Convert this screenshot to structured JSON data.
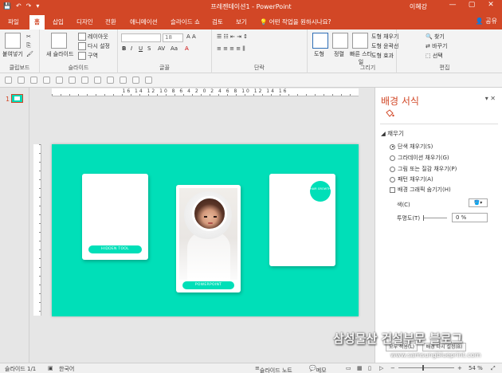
{
  "titlebar": {
    "title": "프레젠테이션1 - PowerPoint",
    "user": "이혜강",
    "qat": [
      "💾",
      "↶",
      "↷",
      "▾"
    ],
    "min": "—",
    "max": "▢",
    "close": "✕"
  },
  "tabs": {
    "file": "파일",
    "home": "홈",
    "insert": "삽입",
    "design": "디자인",
    "transitions": "전환",
    "animations": "애니메이션",
    "slideshow": "슬라이드 쇼",
    "review": "검토",
    "view": "보기",
    "tellme": "어떤 작업을 원하시나요?",
    "share": "공유"
  },
  "ribbon": {
    "paste": "붙여넣기",
    "clipboard": "클립보드",
    "new_slide": "새 슬라이드",
    "layout": "레이아웃",
    "reset": "다시 설정",
    "section": "구역",
    "slides": "슬라이드",
    "font_size": "18",
    "font": "글꼴",
    "paragraph": "단락",
    "shapes": "도형",
    "arrange": "정렬",
    "quick_styles": "빠른 스타일",
    "shape_fill": "도형 채우기",
    "shape_outline": "도형 윤곽선",
    "shape_effects": "도형 효과",
    "drawing": "그리기",
    "find": "찾기",
    "replace": "바꾸기",
    "select": "선택",
    "editing": "편집"
  },
  "ruler": {
    "h_labels": "16 14 12 10 8 6 4 2 0 2 4 6 8 10 12 14 16"
  },
  "thumbnails": {
    "slide_number": "1"
  },
  "slide": {
    "card1_pill": "HIDDEN TOOL",
    "card2_pill": "POWERPOINT",
    "badge": "HAIR GROWTH",
    "background_color": "#00dfb8"
  },
  "pane": {
    "title": "배경 서식",
    "pin": "▾",
    "close": "✕",
    "section": "◢ 채우기",
    "options": [
      "단색 채우기(S)",
      "그라데이션 채우기(G)",
      "그림 또는 질감 채우기(P)",
      "패턴 채우기(A)"
    ],
    "hide_graphics": "배경 그래픽 숨기기(H)",
    "color_label": "색(C)",
    "transparency_label": "투명도(T)",
    "transparency_value": "0 %",
    "apply_all": "모두 적용(L)",
    "reset_bg": "배경 다시 설정(B)"
  },
  "status": {
    "slide_count": "슬라이드 1/1",
    "language": "한국어",
    "notes": "슬라이드 노트",
    "comments": "메모",
    "zoom": "54 %"
  },
  "watermark": {
    "line1": "삼성물산 건설부문 블로그",
    "line2": "www.samsungblueprint.com"
  }
}
